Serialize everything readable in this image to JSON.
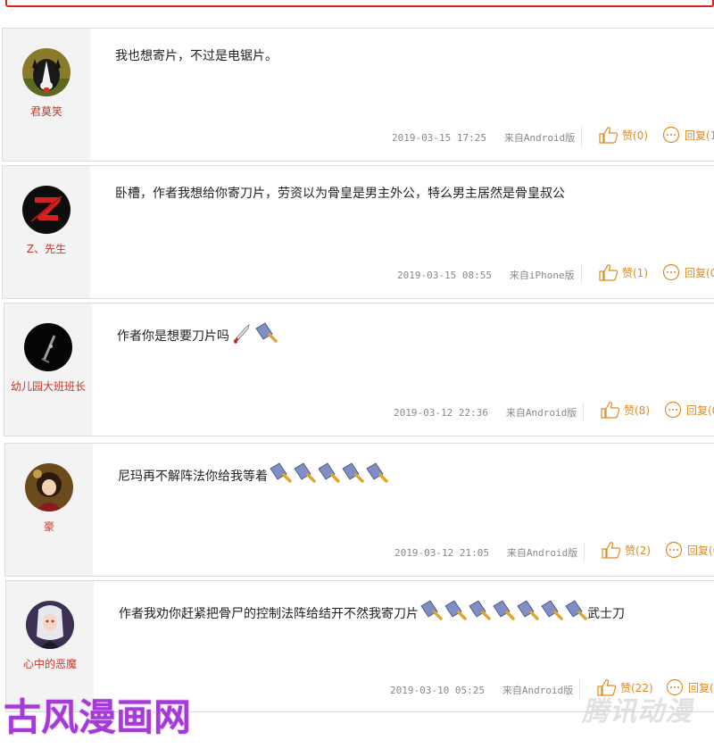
{
  "comments": [
    {
      "username": "君莫笑",
      "content": "我也想寄片，不过是电锯片。",
      "emoji_after": [],
      "suffix": "",
      "date": "2019-03-15 17:25",
      "source": "来自Android版",
      "like_label": "赞(0)",
      "reply_label": "回复(1",
      "avatar": "dog-avatar"
    },
    {
      "username": "Z、先生",
      "content": "卧槽，作者我想给你寄刀片，劳资以为骨皇是男主外公，特么男主居然是骨皇叔公",
      "emoji_after": [],
      "suffix": "",
      "date": "2019-03-15 08:55",
      "source": "来自iPhone版",
      "like_label": "赞(1)",
      "reply_label": "回复(0",
      "avatar": "red-z-avatar"
    },
    {
      "username": "幼儿园大班班长",
      "content": "作者你是想要刀片吗",
      "emoji_after": [
        "bloody-knife-emoji",
        "cleaver-emoji"
      ],
      "suffix": "",
      "date": "2019-03-12 22:36",
      "source": "来自Android版",
      "like_label": "赞(8)",
      "reply_label": "回复(0",
      "avatar": "dark-blade-avatar"
    },
    {
      "username": "豪",
      "content": "尼玛再不解阵法你给我等着",
      "emoji_after": [
        "cleaver-emoji",
        "cleaver-emoji",
        "cleaver-emoji",
        "cleaver-emoji",
        "cleaver-emoji"
      ],
      "suffix": "",
      "date": "2019-03-12 21:05",
      "source": "来自Android版",
      "like_label": "赞(2)",
      "reply_label": "回复(0",
      "avatar": "anime-girl-avatar"
    },
    {
      "username": "心中的恶魔",
      "content": "作者我劝你赶紧把骨尸的控制法阵给结开不然我寄刀片",
      "emoji_after": [
        "cleaver-emoji",
        "cleaver-emoji",
        "cleaver-emoji",
        "cleaver-emoji",
        "cleaver-emoji",
        "cleaver-emoji",
        "cleaver-emoji"
      ],
      "suffix": "武士刀",
      "date": "2019-03-10 05:25",
      "source": "来自Android版",
      "like_label": "赞(22)",
      "reply_label": "回复(",
      "avatar": "white-hair-avatar"
    }
  ],
  "watermark_left": "古风漫画网",
  "watermark_right": "腾讯动漫",
  "colors": {
    "username": "#c0392b",
    "action": "#e08a1e",
    "border_top": "#d9201f",
    "left_bg": "#f3f3f3"
  }
}
